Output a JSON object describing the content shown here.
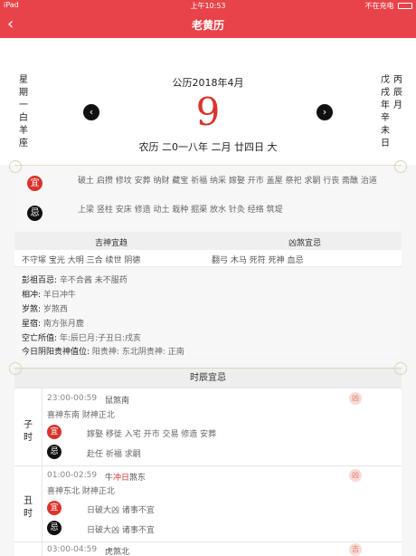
{
  "status": {
    "device": "iPad",
    "time": "上午10:53",
    "charging": "不在充电"
  },
  "nav": {
    "back_icon": "chevron-left-icon",
    "title": "老黄历"
  },
  "date": {
    "weekday_col": "星期一白羊座",
    "right_col1": "戊戌年辛未日",
    "right_col2": "丙辰月",
    "solar": "公历2018年4月",
    "day": "9",
    "prev_icon": "‹",
    "next_icon": "›",
    "lunar": "农历 二0一八年 二月 廿四日 大"
  },
  "yiji": {
    "yi_label": "宜",
    "yi_text": "破土 启攒 修坟 安葬 纳财 藏宝 祈福 纳采 嫁娶 开市 盖屋 祭祀 求嗣 行丧 斋醮 治道",
    "ji_label": "忌",
    "ji_text": "上梁 竖柱 安床 修造 动土 栽种 掘渠 放水 针灸 经络 筑堤"
  },
  "gods": {
    "good_title": "吉神宜趋",
    "bad_title": "凶煞宜忌",
    "good_vals": "不守塚 宝光 大明 三合 续世 阴德",
    "bad_vals": "翻弓 木马 死符 死神 血忌"
  },
  "info": [
    {
      "k": "彭祖百忌:",
      "v": "辛不合酱 未不服药"
    },
    {
      "k": "相冲:",
      "v": "羊日冲牛"
    },
    {
      "k": "岁煞:",
      "v": "岁煞西"
    },
    {
      "k": "星宿:",
      "v": "南方张月鹿"
    },
    {
      "k": "空亡所值:",
      "v": "年:辰巳月:子丑日:戌亥"
    },
    {
      "k": "今日阴阳贵神值位:",
      "v": "阳贵神: 东北阴贵神: 正南"
    }
  ],
  "hours_title": "时辰宜忌",
  "hours": [
    {
      "zhi": "子时",
      "time": "23:00-00:59",
      "chong_pre": "鼠",
      "chong_em": "",
      "chong_post": "煞南",
      "dir": "喜神东南  财神正北",
      "yi_label": "宜",
      "yi": "嫁娶 移徙 入宅 开市 交易 修造 安葬",
      "ji_label": "忌",
      "ji": "赴任 祈福 求嗣",
      "fortune": "凶"
    },
    {
      "zhi": "丑时",
      "time": "01:00-02:59",
      "chong_pre": "牛",
      "chong_em": "冲日",
      "chong_post": "煞东",
      "dir": "喜神东北  财神正北",
      "yi_label": "宜",
      "yi": "日破大凶 诸事不宜",
      "ji_label": "忌",
      "ji": "日破大凶 诸事不宜",
      "fortune": "凶"
    },
    {
      "zhi": "",
      "time": "03:00-04:59",
      "chong_pre": "虎",
      "chong_em": "",
      "chong_post": "煞北",
      "dir": "",
      "yi_label": "",
      "yi": "",
      "ji_label": "",
      "ji": "",
      "fortune": "吉"
    }
  ]
}
